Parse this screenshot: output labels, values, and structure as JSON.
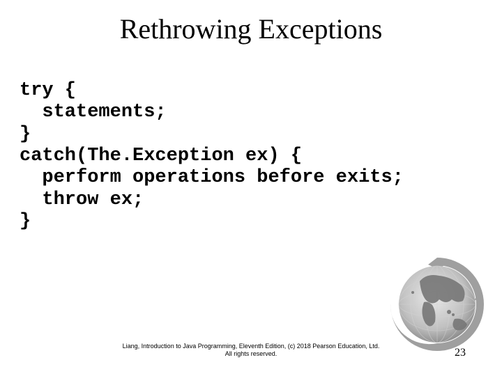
{
  "title": "Rethrowing Exceptions",
  "code": "try {\n  statements;\n}\ncatch(The.Exception ex) {\n  perform operations before exits;\n  throw ex;\n}",
  "footer_line1": "Liang, Introduction to Java Programming, Eleventh Edition, (c) 2018 Pearson Education, Ltd.",
  "footer_line2": "All rights reserved.",
  "page_number": "23"
}
